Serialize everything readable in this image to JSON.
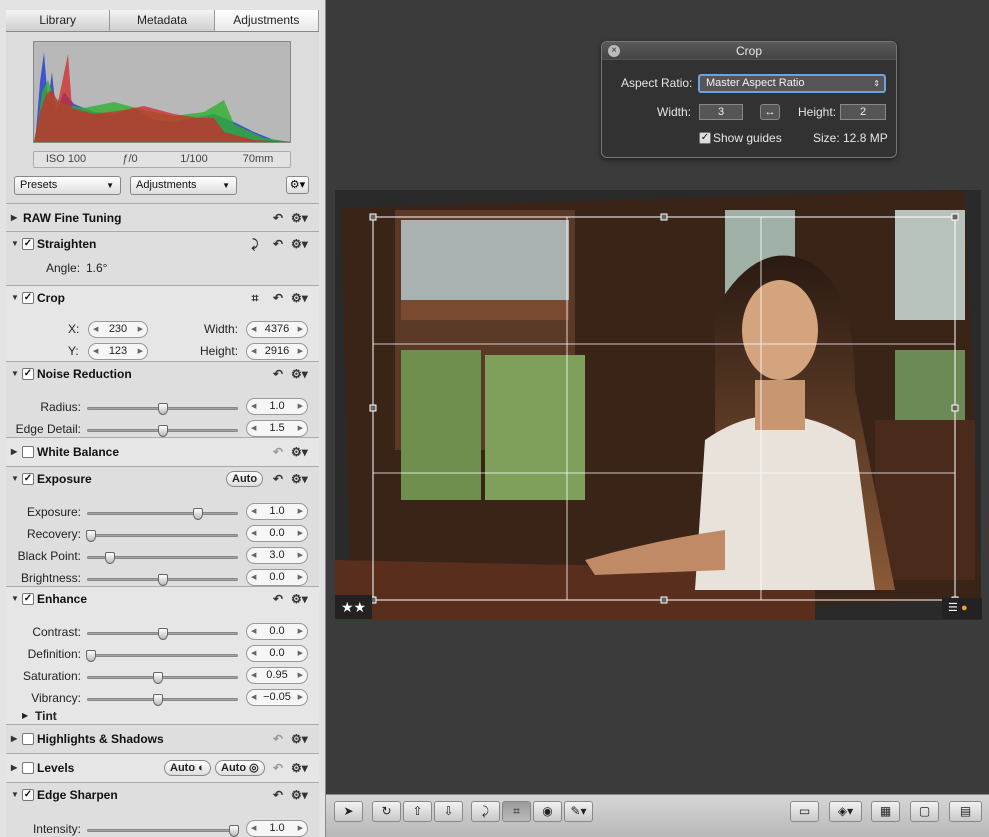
{
  "tabs": [
    "Library",
    "Metadata",
    "Adjustments"
  ],
  "exif": [
    "ISO 100",
    "ƒ/0",
    "1/100",
    "70mm"
  ],
  "presets": "Presets",
  "adjustments_popup": "Adjustments",
  "sections": {
    "raw": "RAW Fine Tuning",
    "straighten": {
      "title": "Straighten",
      "angle_label": "Angle:",
      "angle": "1.6°"
    },
    "crop": {
      "title": "Crop",
      "x_label": "X:",
      "x": "230",
      "y_label": "Y:",
      "y": "123",
      "w_label": "Width:",
      "w": "4376",
      "h_label": "Height:",
      "h": "2916"
    },
    "noise": {
      "title": "Noise Reduction",
      "radius_label": "Radius:",
      "radius": "1.0",
      "radius_pos": 0.5,
      "edge_label": "Edge Detail:",
      "edge": "1.5",
      "edge_pos": 0.5
    },
    "wb": "White Balance",
    "exposure": {
      "title": "Exposure",
      "auto": "Auto",
      "rows": [
        {
          "label": "Exposure:",
          "value": "1.0",
          "pos": 0.74
        },
        {
          "label": "Recovery:",
          "value": "0.0",
          "pos": 0.02
        },
        {
          "label": "Black Point:",
          "value": "3.0",
          "pos": 0.15
        },
        {
          "label": "Brightness:",
          "value": "0.0",
          "pos": 0.5
        }
      ]
    },
    "enhance": {
      "title": "Enhance",
      "rows": [
        {
          "label": "Contrast:",
          "value": "0.0",
          "pos": 0.5
        },
        {
          "label": "Definition:",
          "value": "0.0",
          "pos": 0.02
        },
        {
          "label": "Saturation:",
          "value": "0.95",
          "pos": 0.47
        },
        {
          "label": "Vibrancy:",
          "value": "−0.05",
          "pos": 0.47
        }
      ],
      "tint": "Tint"
    },
    "hs": "Highlights & Shadows",
    "levels": {
      "title": "Levels",
      "auto1": "Auto",
      "auto2": "Auto"
    },
    "sharpen": {
      "title": "Edge Sharpen",
      "rows": [
        {
          "label": "Intensity:",
          "value": "1.0",
          "pos": 0.98
        }
      ]
    }
  },
  "hud": {
    "title": "Crop",
    "aspect_label": "Aspect Ratio:",
    "aspect": "Master Aspect Ratio",
    "width_label": "Width:",
    "width": "3",
    "height_label": "Height:",
    "height": "2",
    "guides": "Show guides",
    "size": "Size: 12.8 MP"
  },
  "rating": "★★"
}
